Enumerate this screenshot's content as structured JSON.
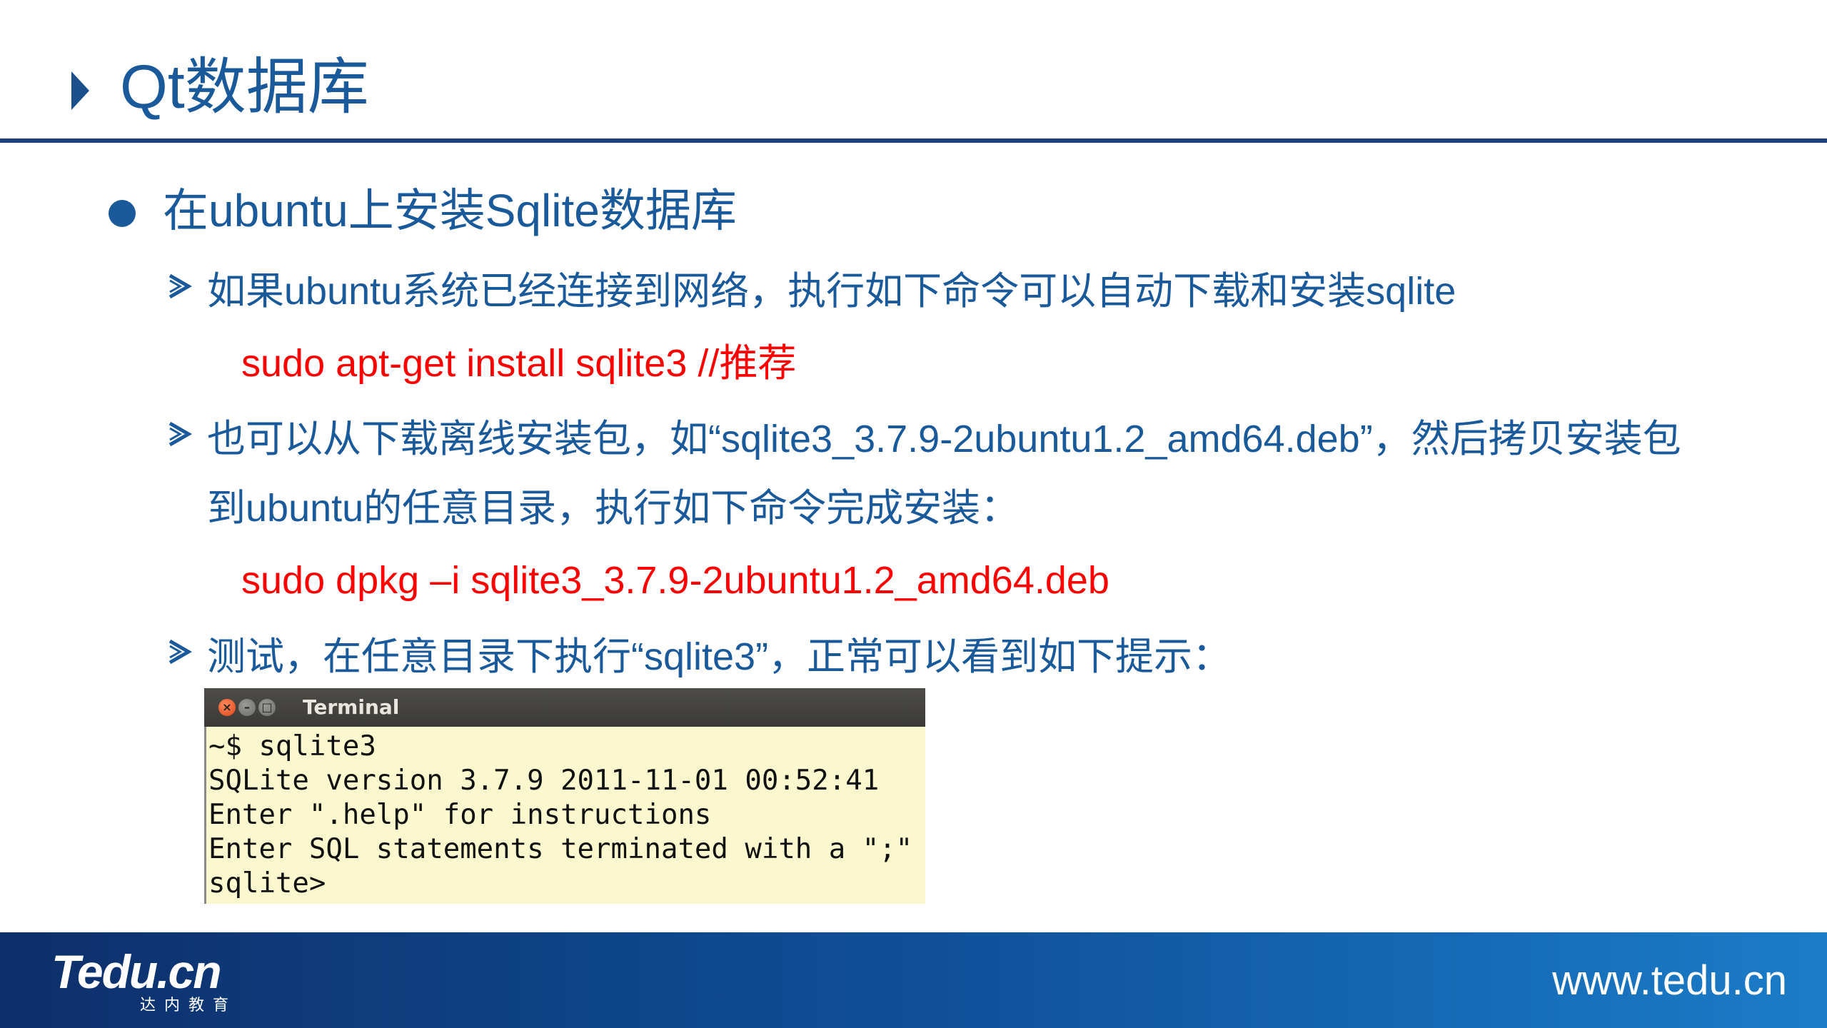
{
  "slide": {
    "title": "Qt数据库"
  },
  "content": {
    "heading": "在ubuntu上安装Sqlite数据库",
    "items": [
      {
        "text": "如果ubuntu系统已经连接到网络，执行如下命令可以自动下载和安装sqlite",
        "command": "sudo apt-get install sqlite3 //推荐"
      },
      {
        "text": "也可以从下载离线安装包，如“sqlite3_3.7.9-2ubuntu1.2_amd64.deb”，然后拷贝安装包",
        "text_cont": "到ubuntu的任意目录，执行如下命令完成安装：",
        "command": "sudo dpkg –i sqlite3_3.7.9-2ubuntu1.2_amd64.deb"
      },
      {
        "text": "测试，在任意目录下执行“sqlite3”，正常可以看到如下提示："
      }
    ]
  },
  "terminal": {
    "title": "Terminal",
    "buttons": [
      "close-icon",
      "minimize-icon",
      "maximize-icon"
    ],
    "lines": [
      "~$ sqlite3",
      "SQLite version 3.7.9 2011-11-01 00:52:41",
      "Enter \".help\" for instructions",
      "Enter SQL statements terminated with a \";\"",
      "sqlite>"
    ]
  },
  "footer": {
    "logo": "Tedu.cn",
    "logo_sub": "达内教育",
    "website": "www.tedu.cn"
  },
  "colors": {
    "title_blue": "#1a5a9a",
    "rule_navy": "#1f3f78",
    "command_red": "#ff0000",
    "terminal_bg": "#fbf8cf",
    "footer_start": "#0d2f6a",
    "footer_end": "#1b7cc8"
  }
}
